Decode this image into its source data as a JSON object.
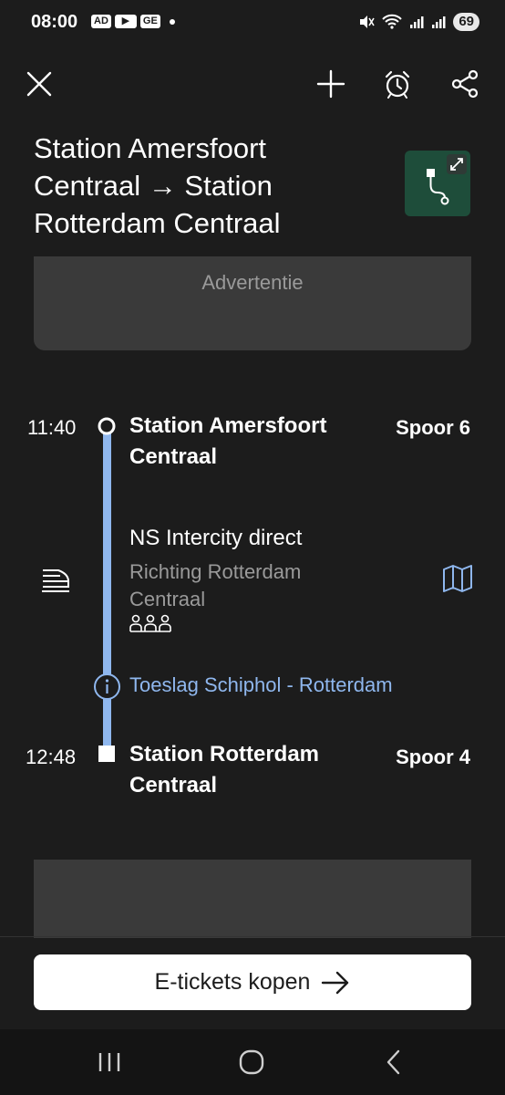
{
  "status_bar": {
    "time": "08:00",
    "badges": [
      "AD",
      "▶",
      "GE"
    ],
    "battery": "69"
  },
  "header": {
    "close_icon": "close-icon",
    "add_icon": "plus-icon",
    "alarm_icon": "alarm-icon",
    "share_icon": "share-icon"
  },
  "title": {
    "line1": "Station Amersfoort",
    "line2": "Centraal → Station",
    "line3": "Rotterdam Centraal"
  },
  "ad": {
    "label": "Advertentie"
  },
  "journey": {
    "departure": {
      "time": "11:40",
      "station_l1": "Station Amersfoort",
      "station_l2": "Centraal",
      "platform": "Spoor 6"
    },
    "train": {
      "name": "NS Intercity direct",
      "direction_l1": "Richting Rotterdam",
      "direction_l2": "Centraal"
    },
    "surcharge": "Toeslag Schiphol - Rotterdam",
    "arrival": {
      "time": "12:48",
      "station_l1": "Station Rotterdam",
      "station_l2": "Centraal",
      "platform": "Spoor 4"
    }
  },
  "cta": {
    "label": "E-tickets kopen"
  },
  "colors": {
    "accent": "#8fb7ee",
    "background": "#1c1c1c",
    "card": "#3a3a3a",
    "map_green": "#1e4d3a"
  }
}
